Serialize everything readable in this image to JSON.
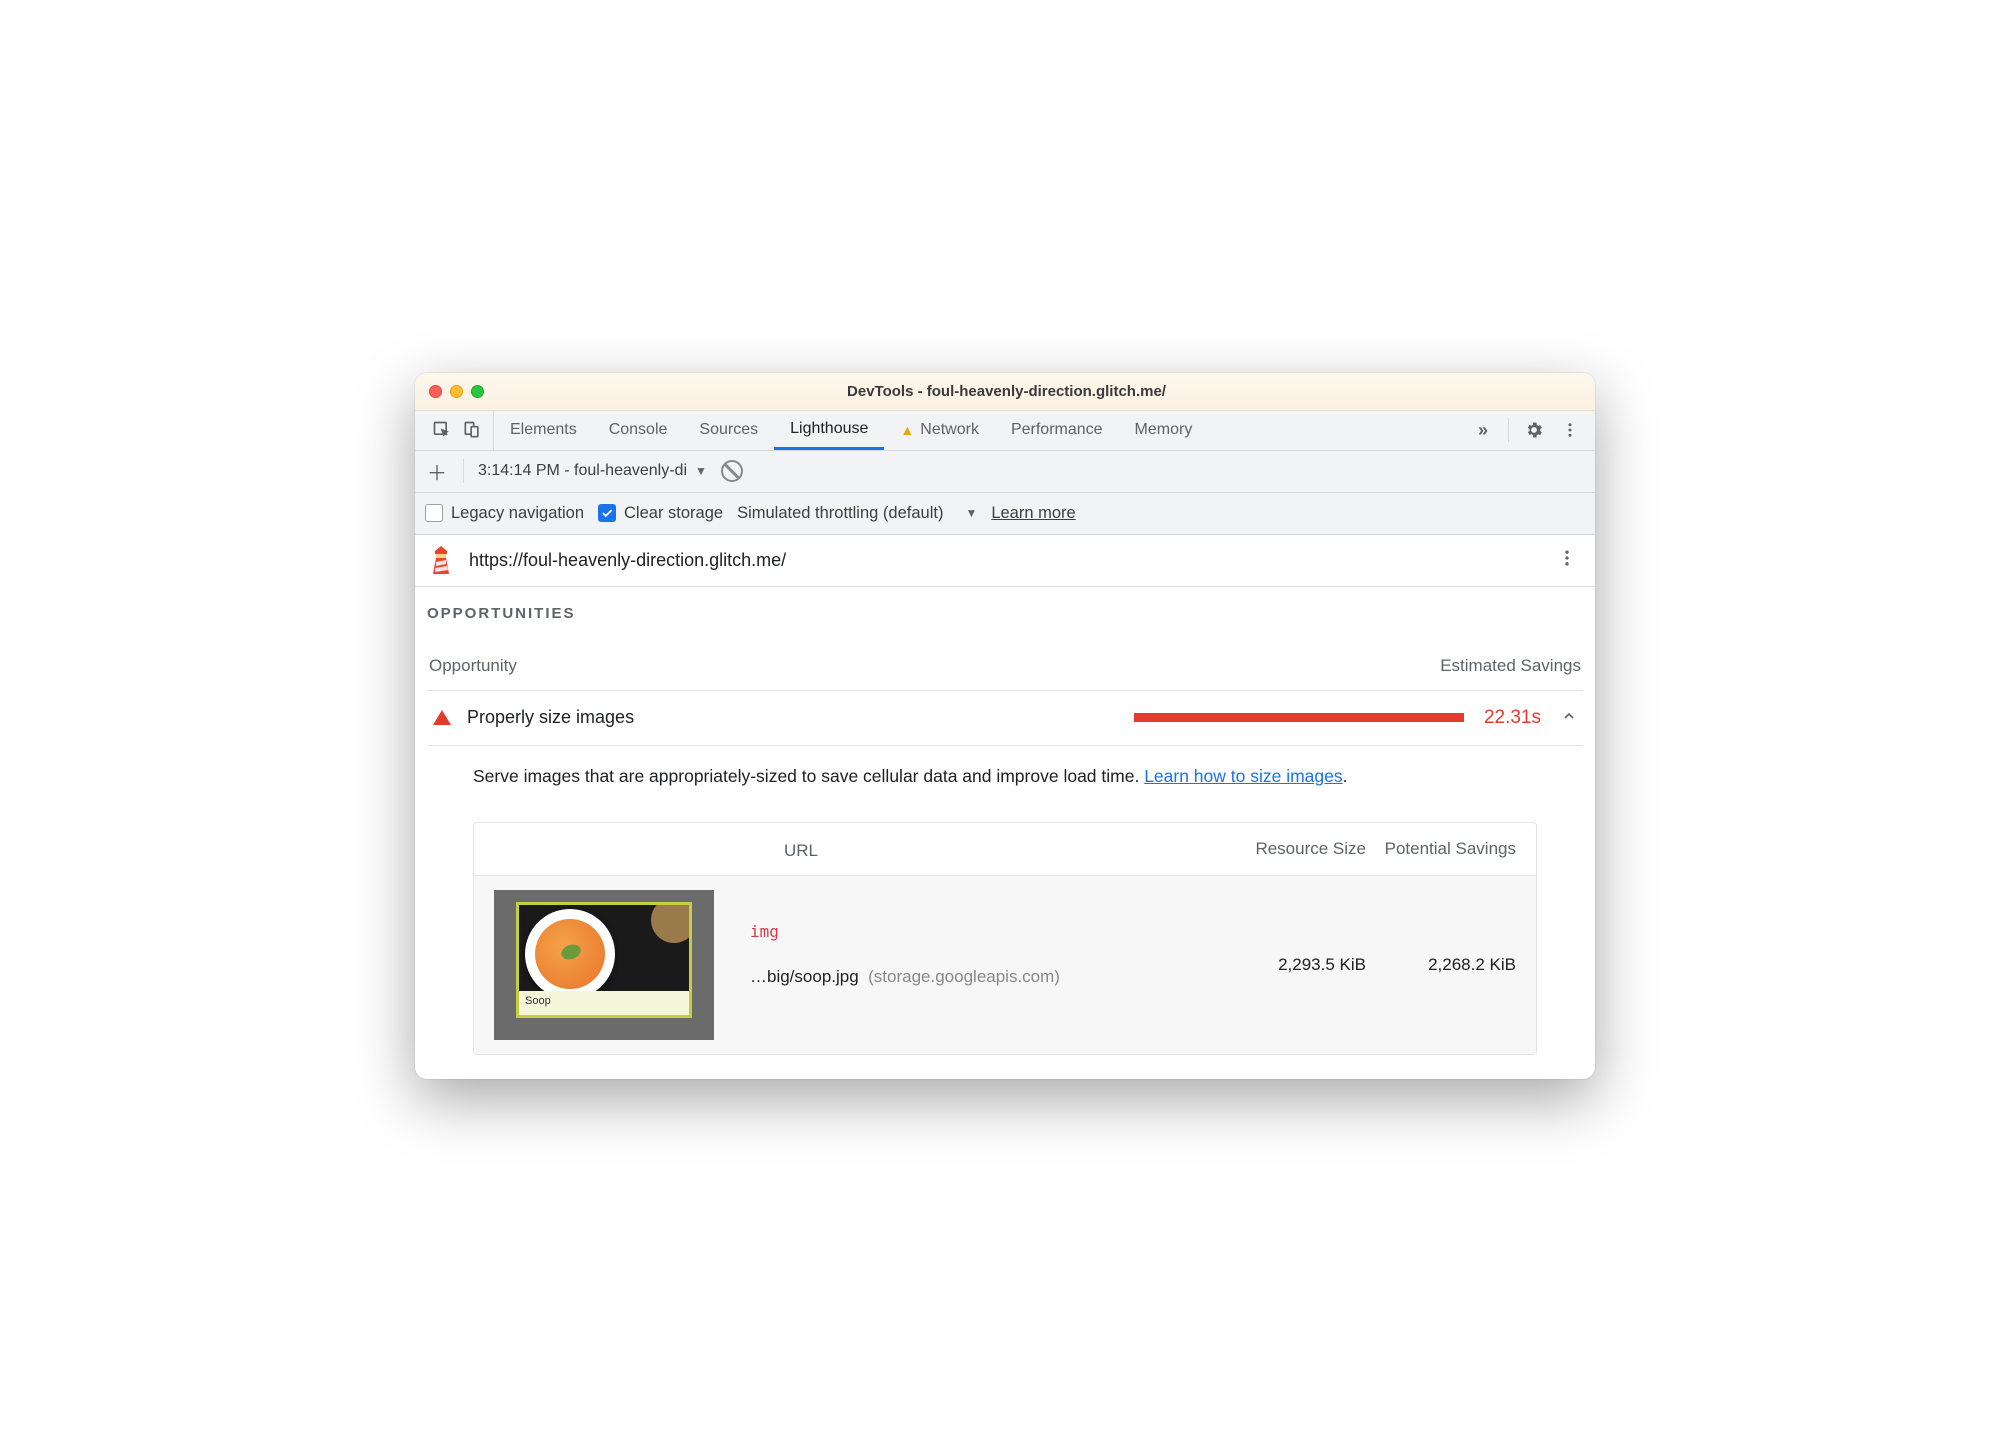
{
  "window": {
    "title": "DevTools - foul-heavenly-direction.glitch.me/"
  },
  "tabs": {
    "items": [
      "Elements",
      "Console",
      "Sources",
      "Lighthouse",
      "Network",
      "Performance",
      "Memory"
    ],
    "active": "Lighthouse",
    "more_symbol": "»"
  },
  "toolbar": {
    "plus": "+",
    "report_label": "3:14:14 PM - foul-heavenly-di"
  },
  "options": {
    "legacy_nav": "Legacy navigation",
    "clear_storage": "Clear storage",
    "throttling": "Simulated throttling (default)",
    "learn_more": "Learn more"
  },
  "urlbar": {
    "url": "https://foul-heavenly-direction.glitch.me/"
  },
  "section": {
    "title": "OPPORTUNITIES",
    "col_opportunity": "Opportunity",
    "col_savings": "Estimated Savings"
  },
  "opportunity": {
    "label": "Properly size images",
    "value": "22.31s"
  },
  "description": {
    "text": "Serve images that are appropriately-sized to save cellular data and improve load time. ",
    "link": "Learn how to size images",
    "tail": "."
  },
  "table": {
    "head_url": "URL",
    "head_size": "Resource Size",
    "head_savings": "Potential Savings",
    "row": {
      "tag": "img",
      "path": "…big/soop.jpg",
      "host": "(storage.googleapis.com)",
      "size": "2,293.5 KiB",
      "savings": "2,268.2 KiB",
      "caption": "Soop"
    }
  }
}
